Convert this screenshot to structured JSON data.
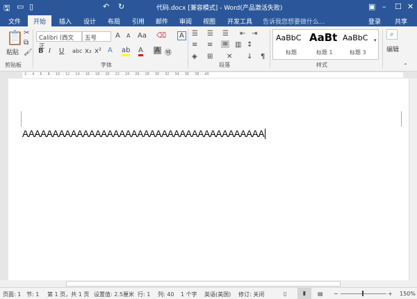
{
  "title": "代码.docx [兼容模式] - Word(产品激活失败)",
  "tabs": [
    "文件",
    "开始",
    "插入",
    "设计",
    "布局",
    "引用",
    "邮件",
    "审阅",
    "视图",
    "开发工具"
  ],
  "tell_me": "告诉我您想要做什么...",
  "login": "登录",
  "share": "共享",
  "clipboard": {
    "paste": "粘贴",
    "group": "剪贴板"
  },
  "font": {
    "name": "Calibri (西文正",
    "size": "五号",
    "group": "字体"
  },
  "paragraph": {
    "group": "段落"
  },
  "styles": {
    "group": "样式",
    "items": [
      {
        "preview": "AaBbC",
        "label": "标题"
      },
      {
        "preview": "AaBt",
        "label": "标题 1"
      },
      {
        "preview": "AaBbC",
        "label": "标题 3"
      }
    ]
  },
  "editing": {
    "label": "编辑"
  },
  "ruler": "· 2 · · 4 · · 6 · · 8 · · 10 · · 12 · · 14 · · 16 · · 18 · · 20 · · 22 · · 24 · · 26 · · 28 · · 30 · · 32 · · 34 · · 36 · · 38 · · 40",
  "document_text": "AAAAAAAAAAAAAAAAAAAAAAAAAAAAAAAAAAAAAAAA",
  "status": {
    "page": "页面: 1",
    "section": "节: 1",
    "pages": "第 1 页，共 1 页",
    "setting": "设置值: 2.5厘米",
    "row": "行: 1",
    "col": "列: 40",
    "words": "1 个字",
    "lang": "英语(美国)",
    "track": "修订: 关闭",
    "zoom": "150%"
  }
}
